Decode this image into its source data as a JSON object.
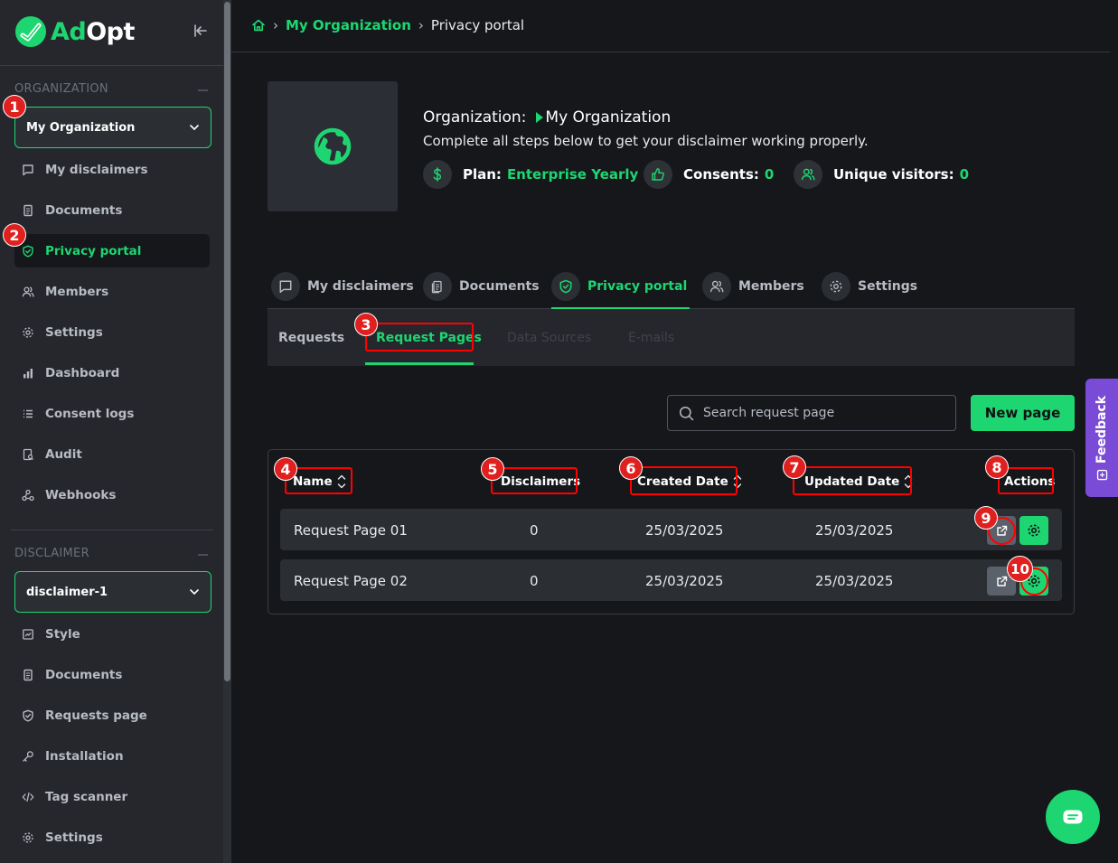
{
  "app": {
    "logo": {
      "part1": "Ad",
      "part2": "Opt"
    }
  },
  "sidebar": {
    "org_section": "ORGANIZATION",
    "org_select": "My Organization",
    "org_items": [
      {
        "label": "My disclaimers",
        "icon": "message-square-icon"
      },
      {
        "label": "Documents",
        "icon": "document-icon"
      },
      {
        "label": "Privacy portal",
        "icon": "shield-check-icon",
        "active": true
      },
      {
        "label": "Members",
        "icon": "users-icon"
      },
      {
        "label": "Settings",
        "icon": "gear-icon"
      },
      {
        "label": "Dashboard",
        "icon": "bar-chart-icon"
      },
      {
        "label": "Consent logs",
        "icon": "list-icon"
      },
      {
        "label": "Audit",
        "icon": "audit-icon"
      },
      {
        "label": "Webhooks",
        "icon": "webhook-icon"
      }
    ],
    "disclaimer_section": "DISCLAIMER",
    "disclaimer_select": "disclaimer-1",
    "disclaimer_items": [
      {
        "label": "Style",
        "icon": "style-icon"
      },
      {
        "label": "Documents",
        "icon": "document-icon"
      },
      {
        "label": "Requests page",
        "icon": "shield-check-icon"
      },
      {
        "label": "Installation",
        "icon": "key-icon"
      },
      {
        "label": "Tag scanner",
        "icon": "code-icon"
      },
      {
        "label": "Settings",
        "icon": "gear-icon"
      }
    ]
  },
  "breadcrumb": {
    "home_icon": "home-icon",
    "org": "My Organization",
    "current": "Privacy portal"
  },
  "org_header": {
    "label": "Organization:",
    "name": "My Organization",
    "subtitle": "Complete all steps below to get your disclaimer working properly.",
    "plan_label": "Plan:",
    "plan_value": "Enterprise Yearly",
    "consents_label": "Consents:",
    "consents_value": "0",
    "visitors_label": "Unique visitors:",
    "visitors_value": "0"
  },
  "tabs": [
    {
      "label": "My disclaimers",
      "icon": "message-square-icon"
    },
    {
      "label": "Documents",
      "icon": "documents-icon"
    },
    {
      "label": "Privacy portal",
      "icon": "shield-check-icon",
      "active": true
    },
    {
      "label": "Members",
      "icon": "users-icon"
    },
    {
      "label": "Settings",
      "icon": "gear-icon"
    }
  ],
  "subtabs": [
    {
      "label": "Requests"
    },
    {
      "label": "Request Pages",
      "active": true
    },
    {
      "label": "Data Sources",
      "disabled": true
    },
    {
      "label": "E-mails",
      "disabled": true
    }
  ],
  "search": {
    "placeholder": "Search request page",
    "value": ""
  },
  "new_button": "New page",
  "table": {
    "columns": [
      "Name",
      "Disclaimers",
      "Created Date",
      "Updated Date",
      "Actions"
    ],
    "rows": [
      {
        "name": "Request Page 01",
        "disclaimers": "0",
        "created": "25/03/2025",
        "updated": "25/03/2025"
      },
      {
        "name": "Request Page 02",
        "disclaimers": "0",
        "created": "25/03/2025",
        "updated": "25/03/2025"
      }
    ]
  },
  "markers": [
    "1",
    "2",
    "3",
    "4",
    "5",
    "6",
    "7",
    "8",
    "9",
    "10"
  ],
  "feedback": "Feedback",
  "colors": {
    "accent": "#1ed671",
    "sidebar": "#25272c",
    "background": "#15171b",
    "marker": "#e01f1f",
    "feedback": "#7a4bd6"
  }
}
